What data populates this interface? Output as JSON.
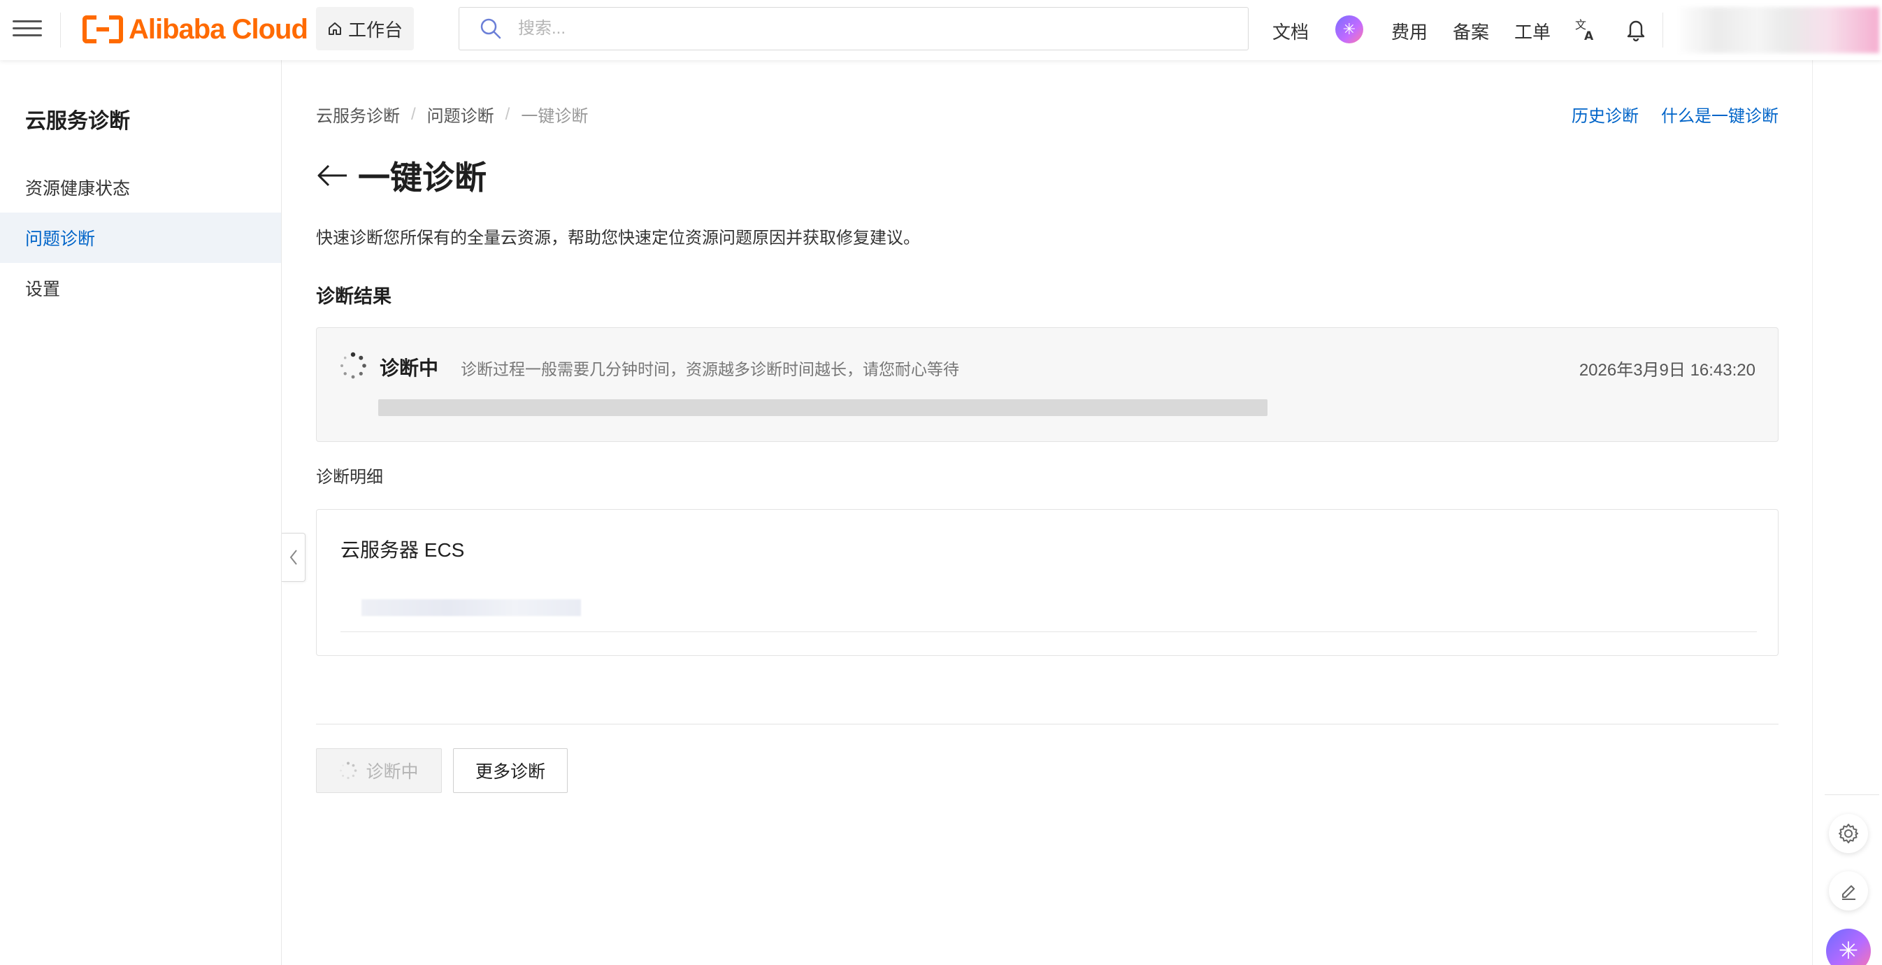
{
  "topbar": {
    "brand": "Alibaba Cloud",
    "workbench": "工作台",
    "search_placeholder": "搜索...",
    "nav": {
      "docs": "文档",
      "billing": "费用",
      "icp": "备案",
      "tickets": "工单"
    },
    "colors": {
      "brand": "#ff6a00",
      "link": "#0064c8"
    }
  },
  "sidebar": {
    "title": "云服务诊断",
    "items": [
      {
        "label": "资源健康状态",
        "active": false
      },
      {
        "label": "问题诊断",
        "active": true
      },
      {
        "label": "设置",
        "active": false
      }
    ]
  },
  "breadcrumb": [
    "云服务诊断",
    "问题诊断",
    "一键诊断"
  ],
  "top_links": {
    "history": "历史诊断",
    "what_is": "什么是一键诊断"
  },
  "page": {
    "title": "一键诊断",
    "description": "快速诊断您所保有的全量云资源，帮助您快速定位资源问题原因并获取修复建议。",
    "result_section": "诊断结果",
    "status": {
      "label": "诊断中",
      "hint": "诊断过程一般需要几分钟时间，资源越多诊断时间越长，请您耐心等待",
      "time": "2026年3月9日 16:43:20",
      "progress": 1.0
    },
    "detail_section": "诊断明细",
    "detail_card_title": "云服务器 ECS"
  },
  "actions": {
    "diagnosing": "诊断中",
    "more": "更多诊断"
  }
}
